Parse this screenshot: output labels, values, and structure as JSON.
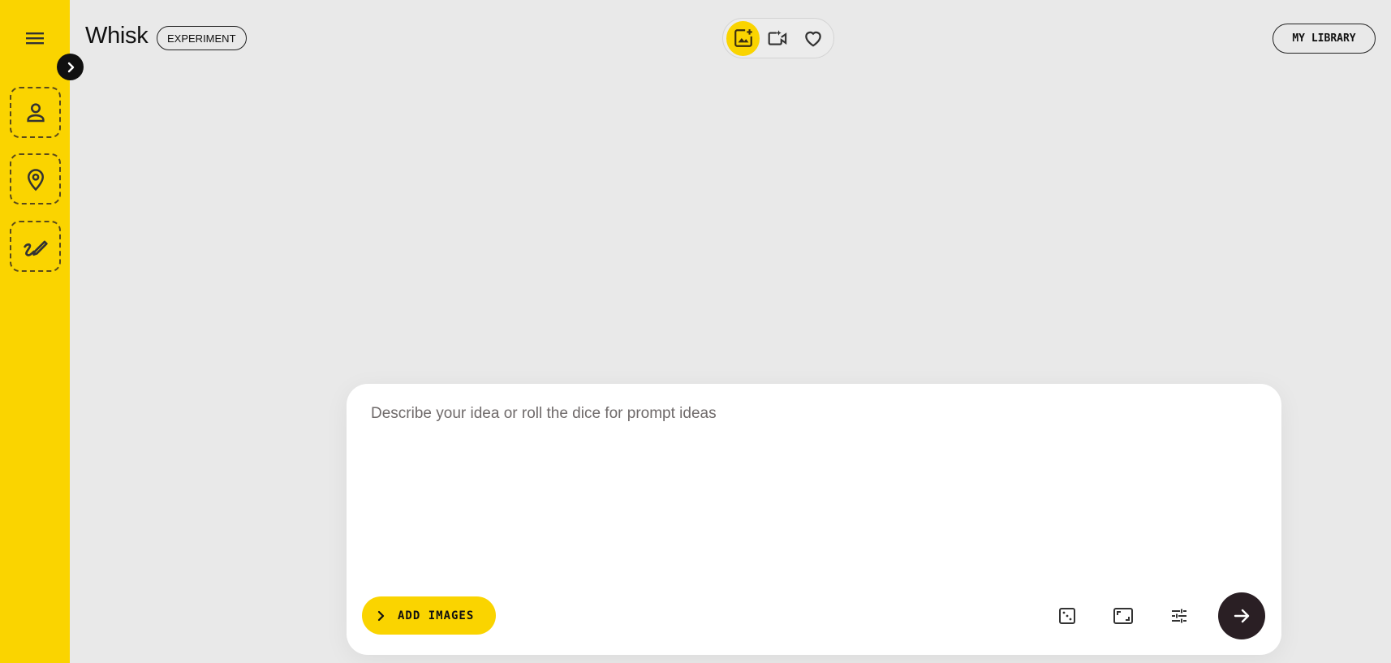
{
  "app": {
    "title": "Whisk",
    "badge": "EXPERIMENT"
  },
  "sidebar": {
    "menu_icon": "hamburger-menu-icon",
    "expand_icon": "chevron-right-icon",
    "slots": [
      {
        "name": "subject",
        "icon": "person-icon"
      },
      {
        "name": "scene",
        "icon": "location-pin-icon"
      },
      {
        "name": "style",
        "icon": "brush-icon"
      }
    ]
  },
  "mode_switch": {
    "items": [
      {
        "name": "image",
        "icon": "add-photo-icon",
        "active": true
      },
      {
        "name": "video",
        "icon": "video-sparkle-icon",
        "active": false
      },
      {
        "name": "favorites",
        "icon": "heart-icon",
        "active": false
      }
    ]
  },
  "header": {
    "library_label": "MY LIBRARY"
  },
  "prompt": {
    "placeholder": "Describe your idea or roll the dice for prompt ideas",
    "value": "",
    "add_images_label": "ADD IMAGES",
    "tools": [
      "dice-icon",
      "aspect-ratio-icon",
      "tune-sliders-icon"
    ],
    "submit_icon": "arrow-right-icon"
  },
  "colors": {
    "accent": "#fad400",
    "background": "#e9e9e9",
    "card": "#ffffff",
    "dark": "#2a1f24"
  }
}
